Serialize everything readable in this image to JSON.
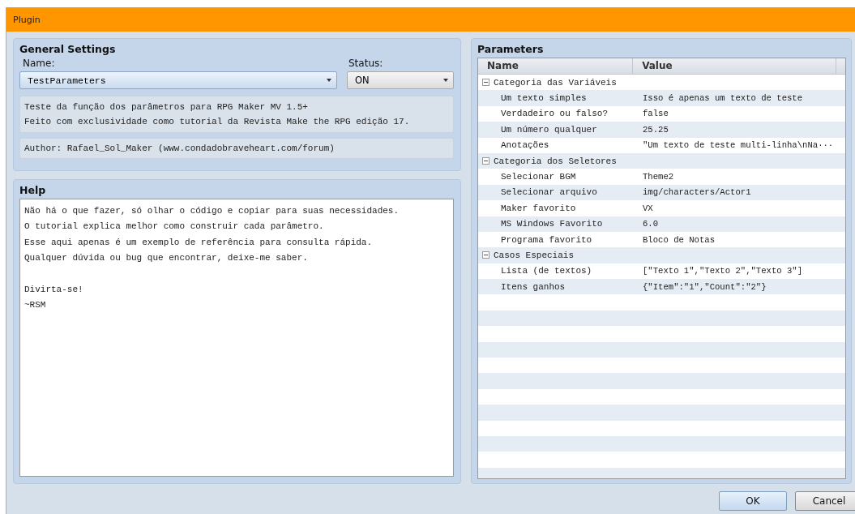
{
  "window": {
    "title": "Plugin"
  },
  "general_settings": {
    "title": "General Settings",
    "name_label": "Name:",
    "name_value": "TestParameters",
    "status_label": "Status:",
    "status_value": "ON",
    "description": [
      "Teste da função dos parâmetros para RPG Maker MV 1.5+",
      "Feito com exclusividade como tutorial da Revista Make the RPG edição 17."
    ],
    "author": "Author: Rafael_Sol_Maker (www.condadobraveheart.com/forum)"
  },
  "help": {
    "title": "Help",
    "paragraphs": [
      [
        "Não há o que fazer, só olhar o código e copiar para suas necessidades.",
        "O tutorial explica melhor como construir cada parâmetro.",
        "Esse aqui apenas é um exemplo de referência para consulta rápida.",
        "Qualquer dúvida ou bug que encontrar, deixe-me saber."
      ],
      [
        "Divirta-se!",
        "~RSM"
      ]
    ]
  },
  "parameters": {
    "title": "Parameters",
    "columns": [
      "Name",
      "Value"
    ],
    "groups": [
      {
        "label": "Categoria das Variáveis",
        "expanded": true,
        "children": [
          {
            "name": "Um texto simples",
            "value": "Isso é apenas um texto de teste"
          },
          {
            "name": "Verdadeiro ou falso?",
            "value": "false"
          },
          {
            "name": "Um número qualquer",
            "value": "25.25"
          },
          {
            "name": "Anotações",
            "value": "\"Um texto de teste multi-linha\\nNa···"
          }
        ]
      },
      {
        "label": "Categoria dos Seletores",
        "expanded": true,
        "children": [
          {
            "name": "Selecionar BGM",
            "value": "Theme2"
          },
          {
            "name": "Selecionar arquivo",
            "value": "img/characters/Actor1"
          },
          {
            "name": "Maker favorito",
            "value": "VX"
          },
          {
            "name": "MS Windows Favorito",
            "value": "6.0"
          },
          {
            "name": "Programa favorito",
            "value": "Bloco de Notas"
          }
        ]
      },
      {
        "label": "Casos Especiais",
        "expanded": true,
        "children": [
          {
            "name": "Lista (de textos)",
            "value": "[\"Texto 1\",\"Texto 2\",\"Texto 3\"]"
          },
          {
            "name": "Itens ganhos",
            "value": "{\"Item\":\"1\",\"Count\":\"2\"}"
          }
        ]
      }
    ]
  },
  "buttons": [
    "OK",
    "Cancel"
  ]
}
